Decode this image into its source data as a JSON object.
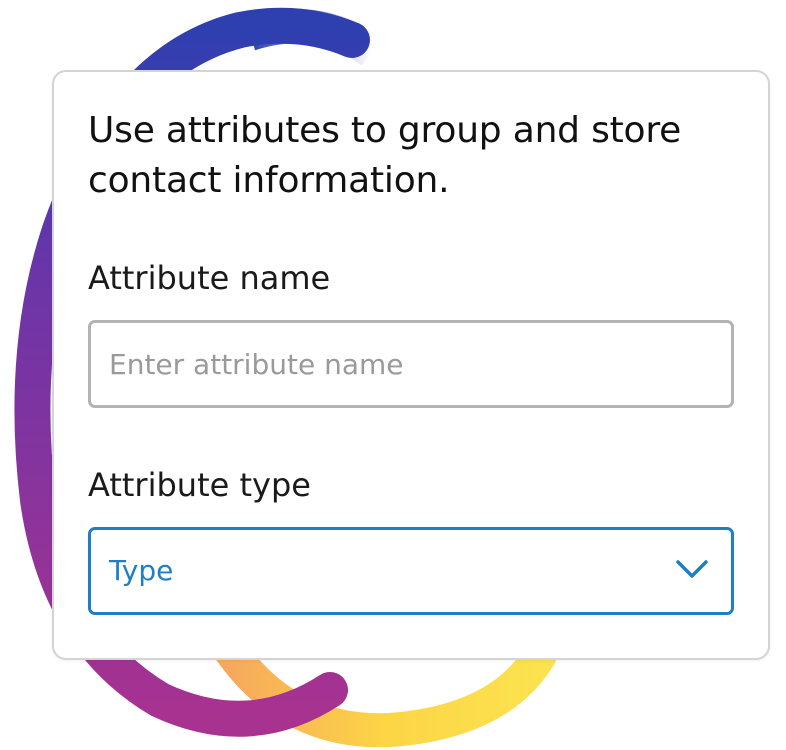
{
  "colors": {
    "accent": "#1f7fc6",
    "input_border": "#b3b3b3",
    "card_border": "#d4d4d4",
    "blob_blue": "#2e3fb0",
    "blob_purple": "#a3308f",
    "blob_yellow": "#fbd24a"
  },
  "form": {
    "heading": "Use attributes to group and store contact information.",
    "name_field": {
      "label": "Attribute name",
      "placeholder": "Enter attribute name",
      "value": ""
    },
    "type_field": {
      "label": "Attribute type",
      "selected": "Type",
      "icon": "chevron-down-icon"
    }
  }
}
